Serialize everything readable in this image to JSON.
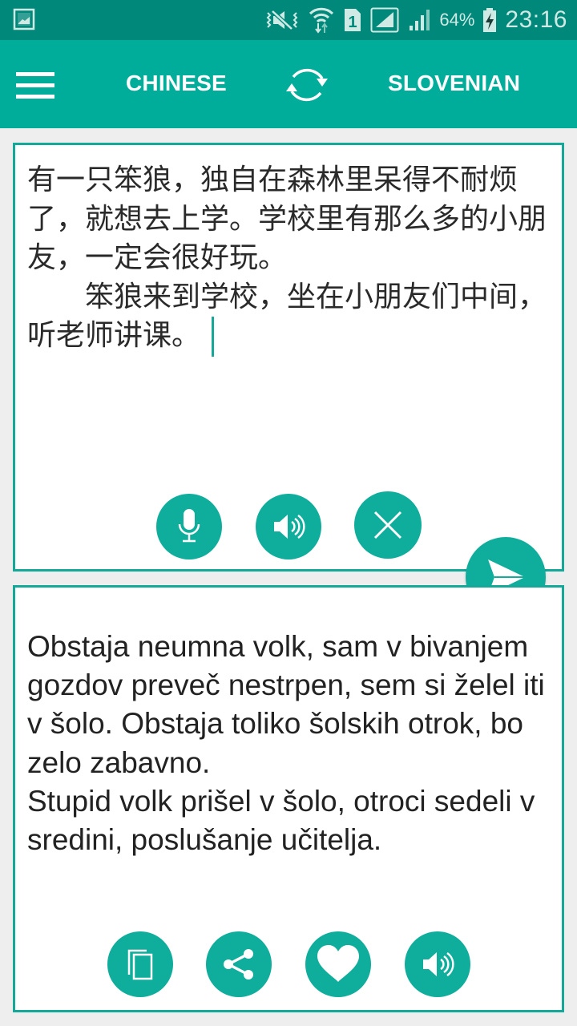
{
  "status_bar": {
    "left_icon": "gallery-notification-icon",
    "icons": [
      "vibrate-mute-icon",
      "wifi-data-icon",
      "sim1-icon",
      "signal-sim1-icon",
      "signal-sim2-icon",
      "battery-charging-icon"
    ],
    "battery_percent": "64%",
    "time": "23:16"
  },
  "app_bar": {
    "menu_icon": "hamburger-menu-icon",
    "source_language": "CHINESE",
    "swap_icon": "swap-languages-icon",
    "target_language": "SLOVENIAN"
  },
  "input_panel": {
    "text": "有一只笨狼，独自在森林里呆得不耐烦了，就想去上学。学校里有那么多的小朋友，一定会很好玩。\n　　笨狼来到学校，坐在小朋友们中间，听老师讲课。",
    "buttons": [
      {
        "name": "microphone",
        "icon": "microphone-icon"
      },
      {
        "name": "speak-source",
        "icon": "speaker-icon"
      },
      {
        "name": "clear",
        "icon": "close-icon"
      }
    ]
  },
  "translate_button": {
    "icon": "send-icon"
  },
  "output_panel": {
    "text": "Obstaja neumna volk, sam v bivanjem gozdov preveč nestrpen, sem si želel iti v šolo. Obstaja toliko šolskih otrok, bo zelo zabavno.\nStupid volk prišel v šolo, otroci sedeli v sredini, poslušanje učitelja.",
    "buttons": [
      {
        "name": "copy",
        "icon": "copy-icon"
      },
      {
        "name": "share",
        "icon": "share-icon"
      },
      {
        "name": "favorite",
        "icon": "heart-icon"
      },
      {
        "name": "speak-target",
        "icon": "speaker-icon"
      }
    ]
  },
  "colors": {
    "status_bar": "#00897b",
    "app_bar": "#00ad9a",
    "accent": "#0fad9b",
    "panel_border": "#13a898",
    "background": "#eeeeee"
  }
}
